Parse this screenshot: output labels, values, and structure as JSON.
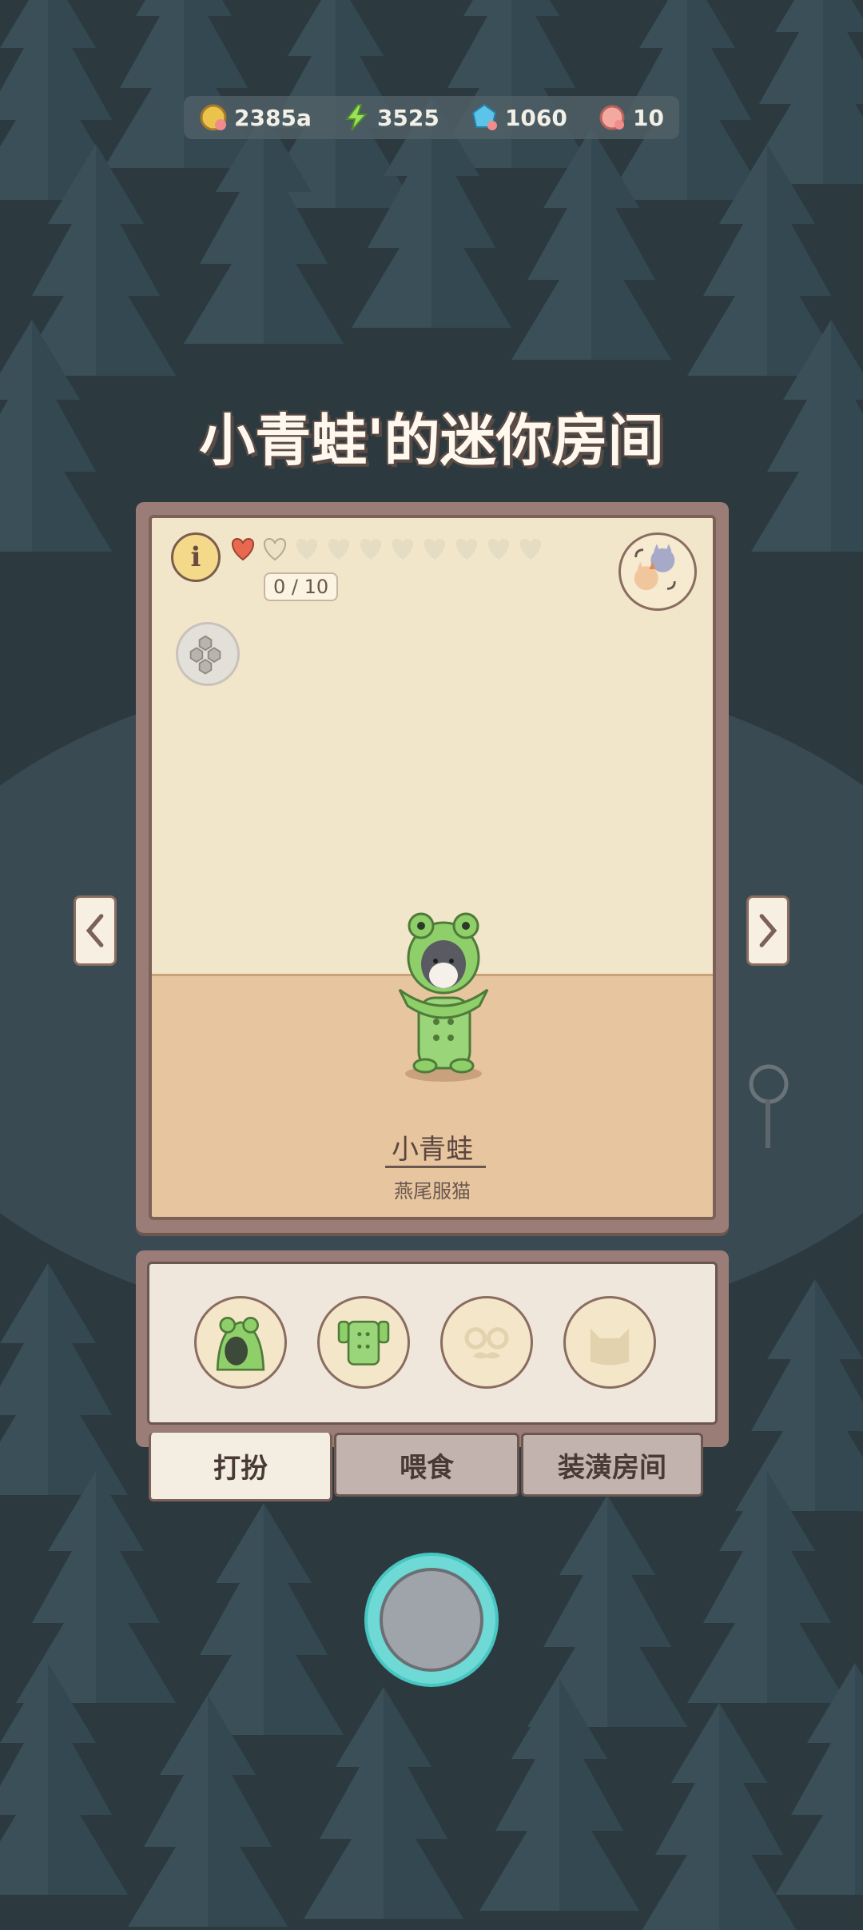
{
  "resources": [
    {
      "icon": "coin-icon",
      "value": "2385a"
    },
    {
      "icon": "energy-icon",
      "value": "3525"
    },
    {
      "icon": "gem-icon",
      "value": "1060"
    },
    {
      "icon": "ticket-icon",
      "value": "10"
    }
  ],
  "page_title": "小青蛙'的迷你房间",
  "room": {
    "love_count": "0 / 10",
    "cat_name": "小青蛙",
    "cat_type": "燕尾服猫"
  },
  "tabs": [
    {
      "label": "打扮"
    },
    {
      "label": "喂食"
    },
    {
      "label": "装潢房间"
    }
  ],
  "colors": {
    "wall": "#f1e6c9",
    "floor": "#e7c69f",
    "frog_green": "#8fcf6a",
    "action_ring": "#6fd9d6"
  }
}
